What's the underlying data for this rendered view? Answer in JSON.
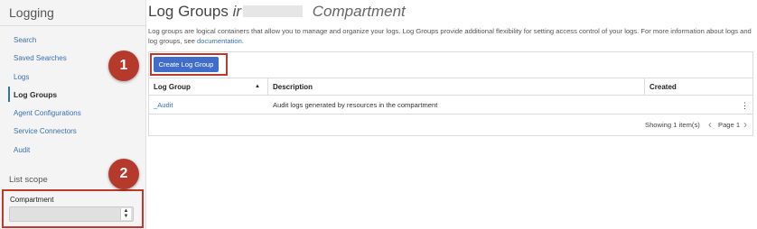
{
  "sidebar": {
    "title": "Logging",
    "items": [
      {
        "label": "Search"
      },
      {
        "label": "Saved Searches"
      },
      {
        "label": "Logs"
      },
      {
        "label": "Log Groups"
      },
      {
        "label": "Agent Configurations"
      },
      {
        "label": "Service Connectors"
      },
      {
        "label": "Audit"
      }
    ],
    "active_item": "Log Groups",
    "list_scope_label": "List scope",
    "compartment_label": "Compartment",
    "compartment_value": ""
  },
  "header": {
    "title": "Log Groups",
    "title_name_visible": "ir",
    "title_suffix": "Compartment"
  },
  "description": {
    "text": "Log groups are logical containers that allow you to manage and organize your logs. Log Groups provide additional flexibility for setting access control of your logs. For more information about logs and log groups, see ",
    "link_text": "documentation",
    "end": "."
  },
  "toolbar": {
    "create_label": "Create Log Group"
  },
  "table": {
    "columns": [
      "Log Group",
      "Description",
      "Created"
    ],
    "rows": [
      {
        "log_group": "_Audit",
        "description": "Audit logs generated by resources in the compartment",
        "created": ""
      }
    ]
  },
  "pagination": {
    "showing": "Showing 1 item(s)",
    "page": "Page 1"
  },
  "callouts": [
    "1",
    "2"
  ],
  "colors": {
    "accent": "#3f6dc8",
    "link": "#3a6fb0",
    "callout": "#b63a2c"
  }
}
